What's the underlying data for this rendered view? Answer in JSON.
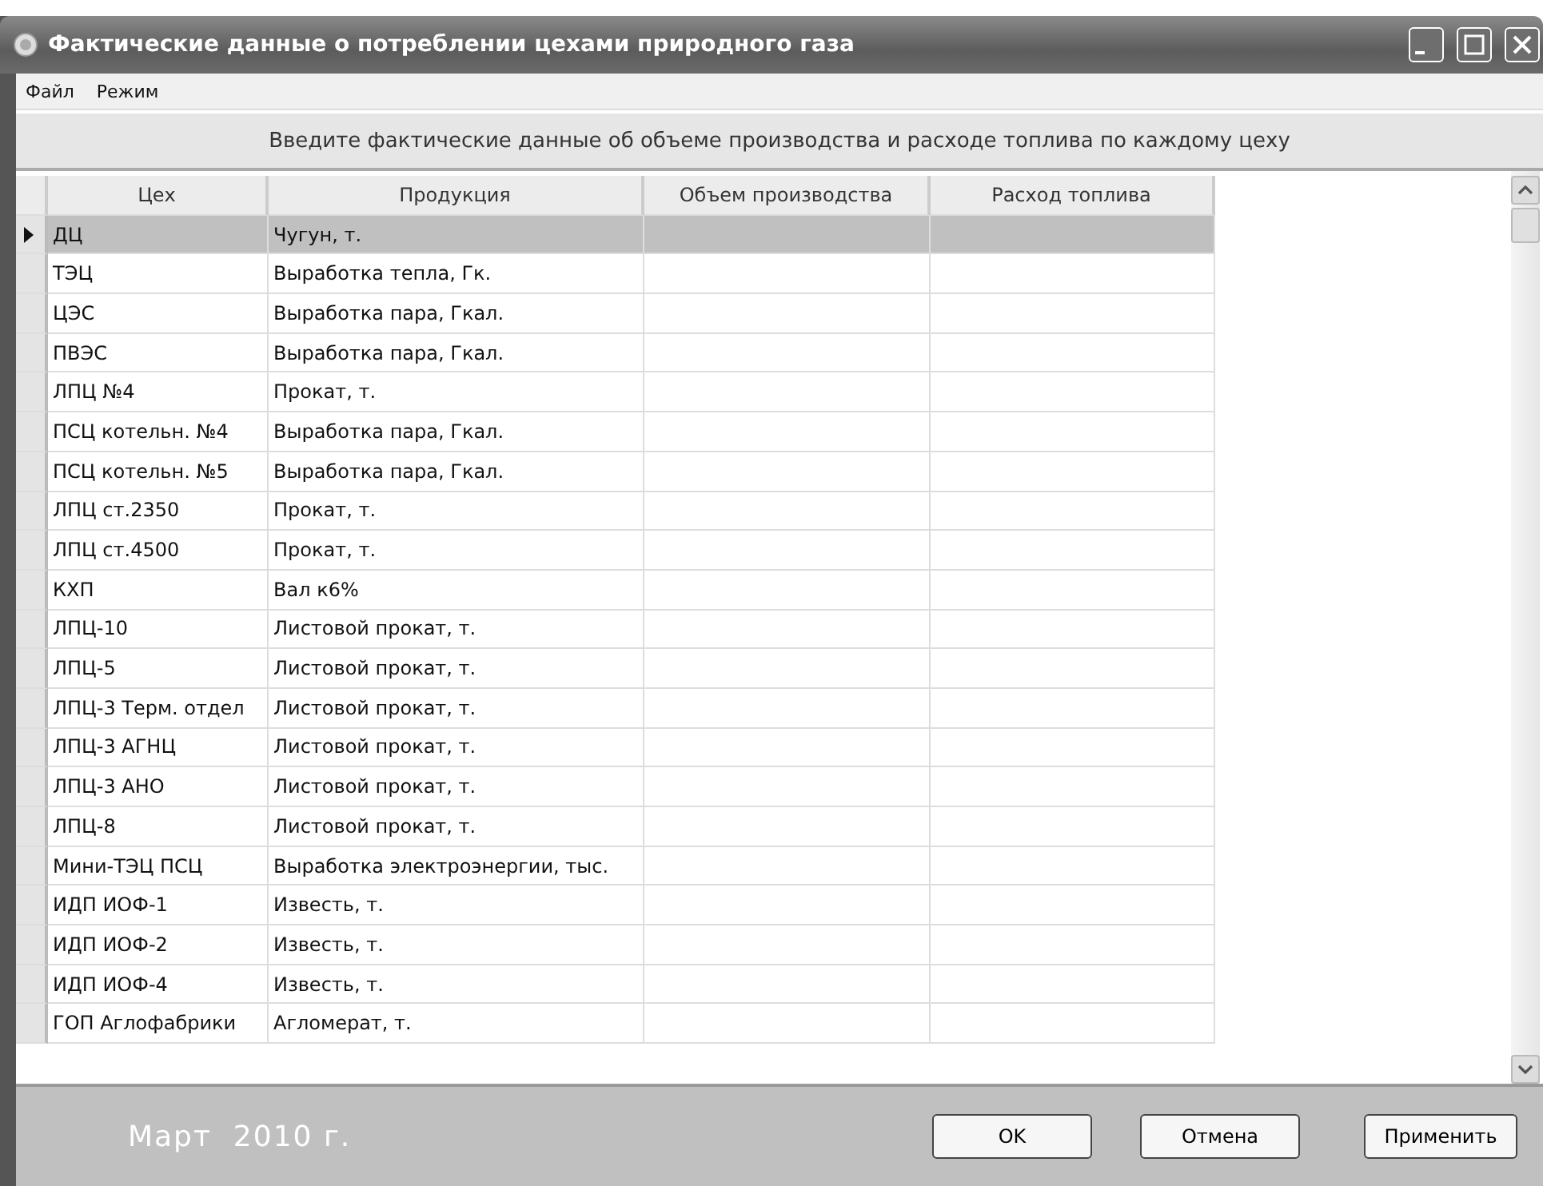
{
  "window": {
    "title": "Фактические данные о потреблении цехами природного газа"
  },
  "menu": [
    "Файл",
    "Режим"
  ],
  "banner": "Введите фактические данные об объеме производства и расходе топлива по каждому цеху",
  "table": {
    "columns": [
      "Цех",
      "Продукция",
      "Объем производства",
      "Расход топлива"
    ],
    "rows": [
      {
        "shop": "ДЦ",
        "product": "Чугун, т.",
        "selected": true
      },
      {
        "shop": "ТЭЦ",
        "product": "Выработка тепла, Гк.",
        "selected": false
      },
      {
        "shop": "ЦЭС",
        "product": "Выработка пара, Гкал.",
        "selected": false
      },
      {
        "shop": "ПВЭС",
        "product": "Выработка пара, Гкал.",
        "selected": false
      },
      {
        "shop": "ЛПЦ №4",
        "product": "Прокат, т.",
        "selected": false
      },
      {
        "shop": "ПСЦ котельн. №4",
        "product": "Выработка пара, Гкал.",
        "selected": false
      },
      {
        "shop": "ПСЦ котельн. №5",
        "product": "Выработка пара, Гкал.",
        "selected": false
      },
      {
        "shop": "ЛПЦ ст.2350",
        "product": "Прокат, т.",
        "selected": false
      },
      {
        "shop": "ЛПЦ ст.4500",
        "product": "Прокат, т.",
        "selected": false
      },
      {
        "shop": "КХП",
        "product": "Вал к6%",
        "selected": false
      },
      {
        "shop": "ЛПЦ-10",
        "product": "Листовой прокат, т.",
        "selected": false
      },
      {
        "shop": "ЛПЦ-5",
        "product": "Листовой прокат, т.",
        "selected": false
      },
      {
        "shop": "ЛПЦ-3 Терм. отдел",
        "product": "Листовой прокат, т.",
        "selected": false
      },
      {
        "shop": "ЛПЦ-3 АГНЦ",
        "product": "Листовой прокат, т.",
        "selected": false
      },
      {
        "shop": "ЛПЦ-3 АНО",
        "product": "Листовой прокат, т.",
        "selected": false
      },
      {
        "shop": "ЛПЦ-8",
        "product": "Листовой прокат, т.",
        "selected": false
      },
      {
        "shop": "Мини-ТЭЦ ПСЦ",
        "product": "Выработка электроэнергии, тыс.",
        "selected": false
      },
      {
        "shop": "ИДП ИОФ-1",
        "product": "Известь, т.",
        "selected": false
      },
      {
        "shop": "ИДП ИОФ-2",
        "product": "Известь, т.",
        "selected": false
      },
      {
        "shop": "ИДП ИОФ-4",
        "product": "Известь, т.",
        "selected": false
      },
      {
        "shop": "ГОП Аглофабрики",
        "product": "Агломерат, т.",
        "selected": false
      }
    ]
  },
  "period": "Март  2010 г.",
  "buttons": [
    "OK",
    "Отмена",
    "Применить"
  ]
}
